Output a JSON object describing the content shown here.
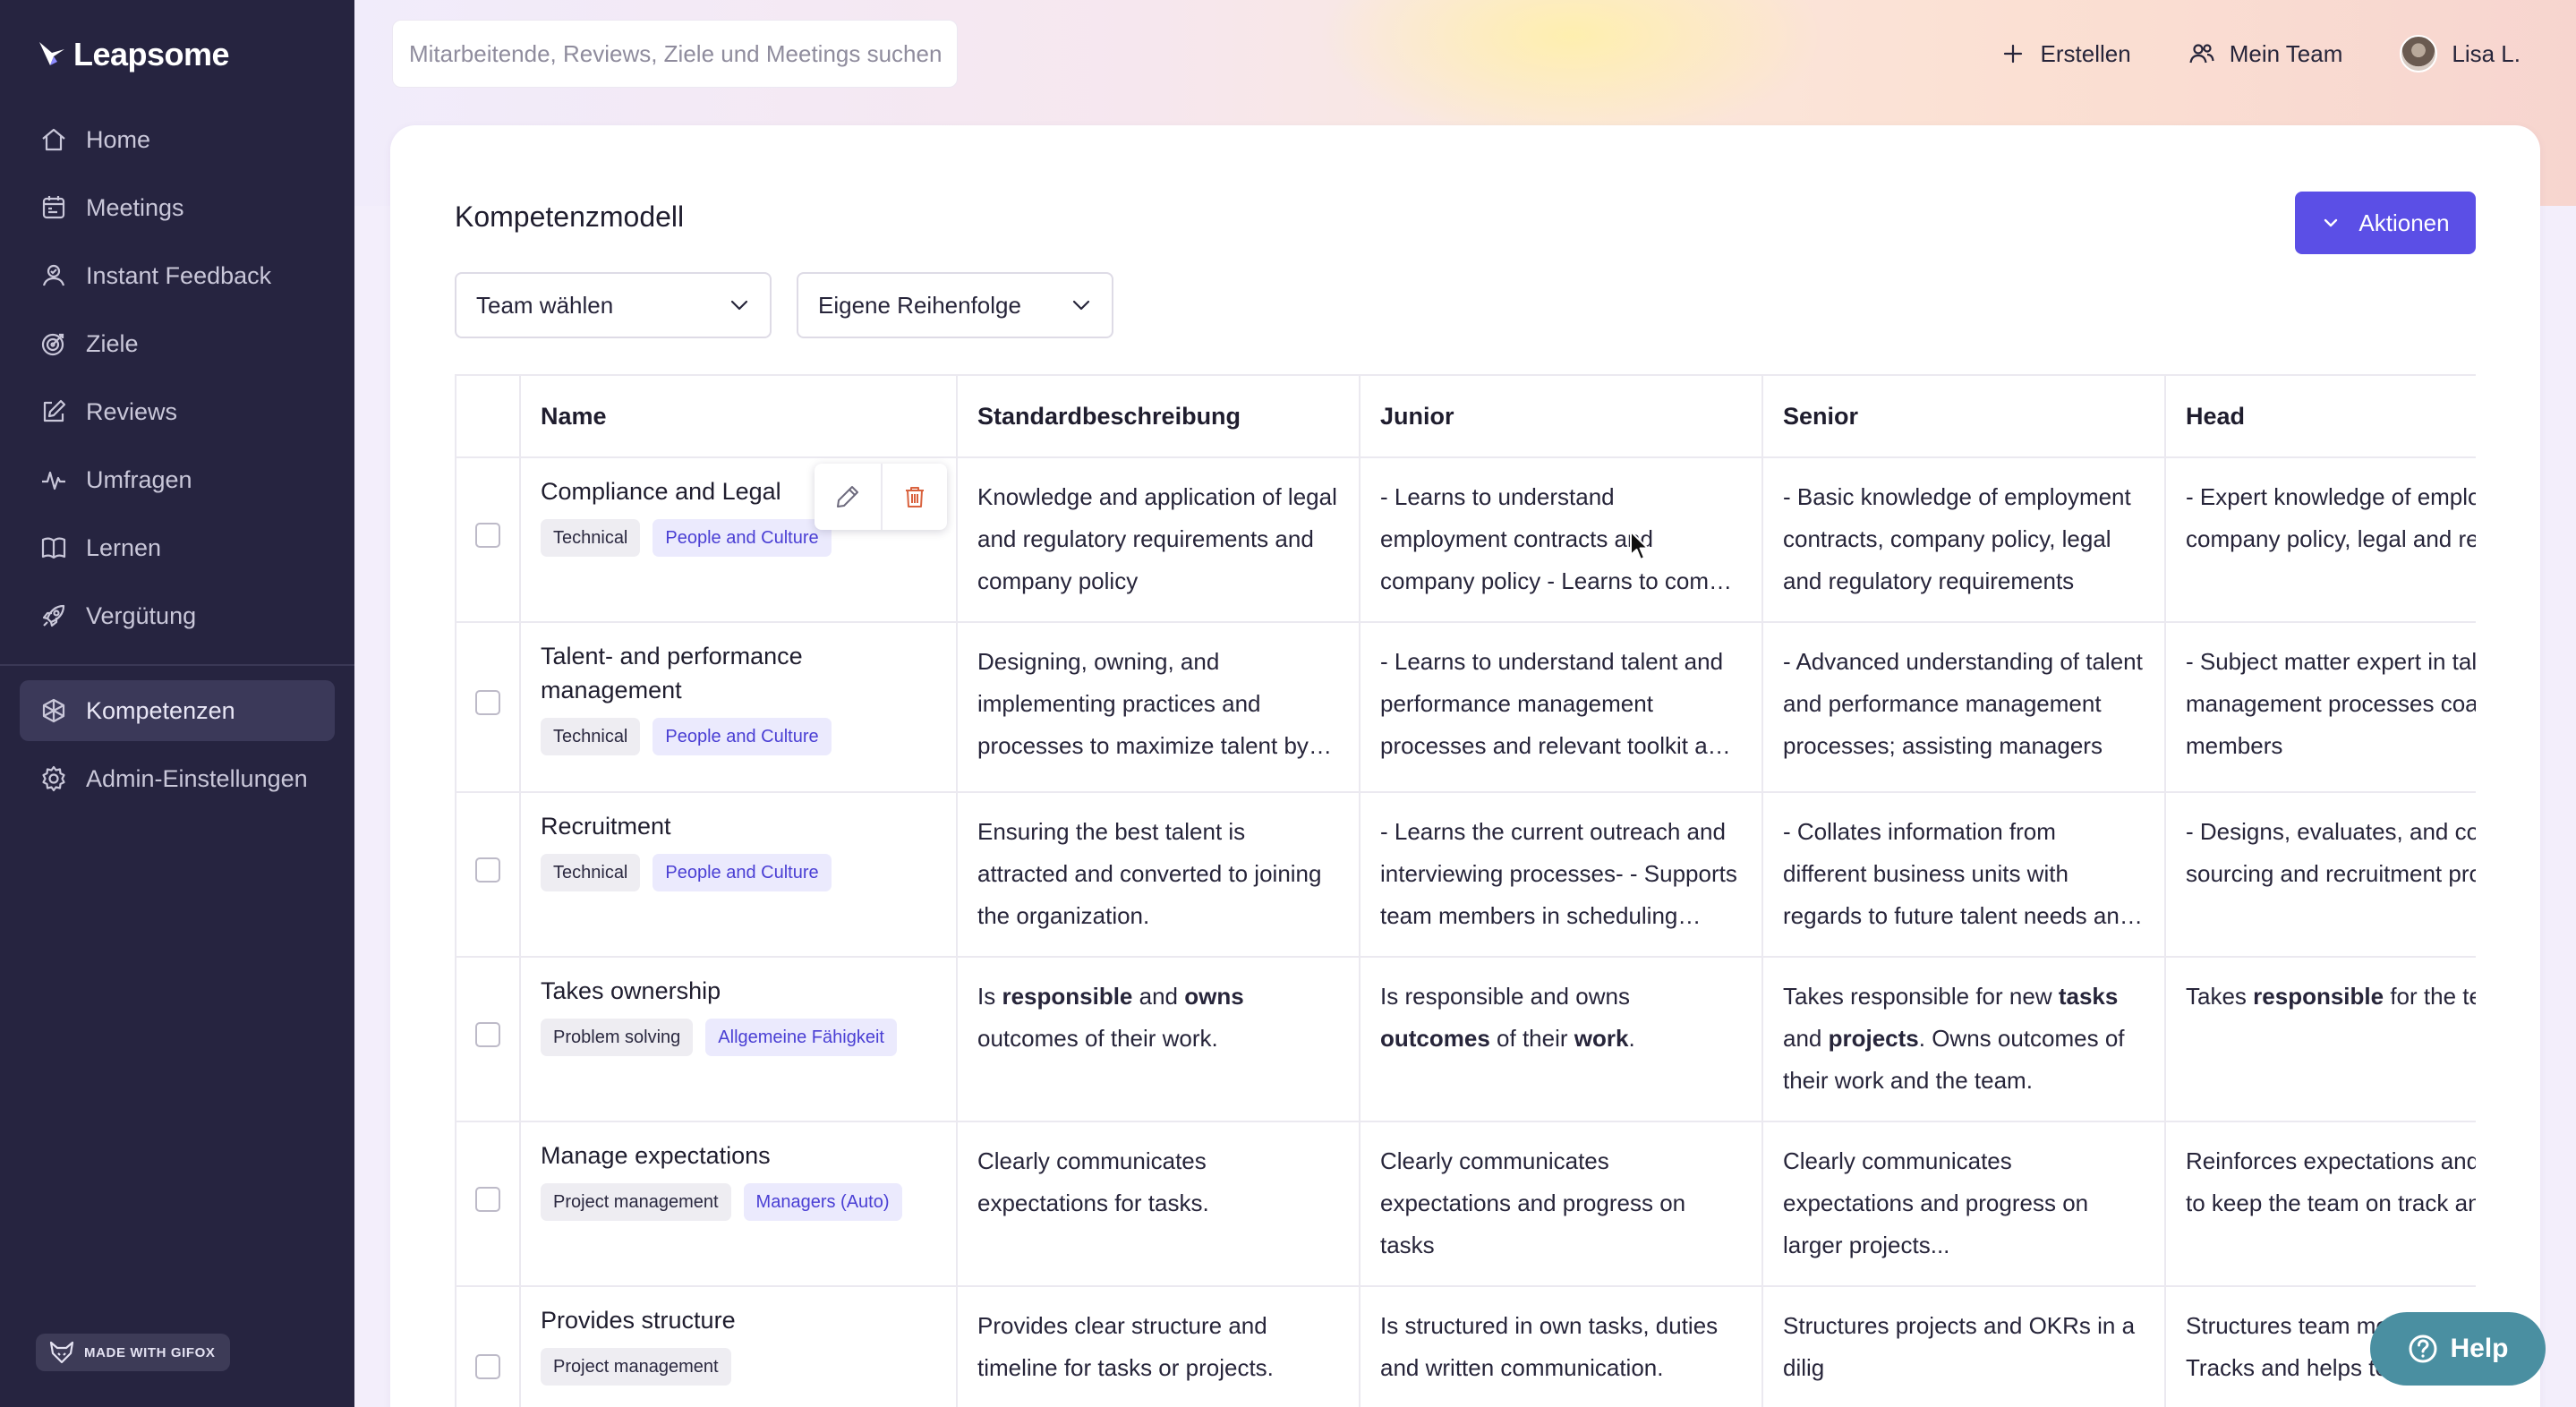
{
  "brand": {
    "name": "Leapsome"
  },
  "sidebar": {
    "items": [
      {
        "label": "Home",
        "icon": "home-icon"
      },
      {
        "label": "Meetings",
        "icon": "calendar-icon"
      },
      {
        "label": "Instant Feedback",
        "icon": "feedback-icon"
      },
      {
        "label": "Ziele",
        "icon": "target-icon"
      },
      {
        "label": "Reviews",
        "icon": "edit-icon"
      },
      {
        "label": "Umfragen",
        "icon": "pulse-icon"
      },
      {
        "label": "Lernen",
        "icon": "book-icon"
      },
      {
        "label": "Vergütung",
        "icon": "rocket-icon"
      }
    ],
    "bottom_items": [
      {
        "label": "Kompetenzen",
        "icon": "competency-icon",
        "active": true
      },
      {
        "label": "Admin-Einstellungen",
        "icon": "gear-icon"
      }
    ],
    "gifox_badge": "MADE WITH GIFOX"
  },
  "topbar": {
    "search_placeholder": "Mitarbeitende, Reviews, Ziele und Meetings suchen",
    "create_label": "Erstellen",
    "team_label": "Mein Team",
    "user_label": "Lisa L."
  },
  "page": {
    "title": "Kompetenzmodell",
    "actions_label": "Aktionen",
    "team_select": "Team wählen",
    "order_select": "Eigene Reihenfolge"
  },
  "table": {
    "headers": [
      "Name",
      "Standardbeschreibung",
      "Junior",
      "Senior",
      "Head"
    ],
    "rows": [
      {
        "name": "Compliance and Legal",
        "tags": [
          "Technical",
          "People and Culture"
        ],
        "standard": "Knowledge and application of legal and regulatory requirements and company policy",
        "junior": "- Learns to understand employment contracts and company policy - Learns to comply with legal and regulatory requirements",
        "senior": "- Basic knowledge of employment contracts, company policy, legal and regulatory requirements",
        "head": "- Expert knowledge of employment contracts, company policy, legal and regulatory requirements"
      },
      {
        "name": "Talent- and performance management",
        "tags": [
          "Technical",
          "People and Culture"
        ],
        "standard": "Designing, owning, and implementing practices and processes to maximize talent by developing employees",
        "junior": "- Learns to understand talent and performance management processes and relevant toolkit and frameworks",
        "senior": "- Advanced understanding of talent and performance management processes; assisting managers",
        "head": "- Subject matter expert in talent and performance management processes coaches junior team members"
      },
      {
        "name": "Recruitment",
        "tags": [
          "Technical",
          "People and Culture"
        ],
        "standard": "Ensuring the best talent is attracted and converted to joining the organization.",
        "junior": "- Learns the current outreach and interviewing processes- - Supports team members in scheduling interviews",
        "senior": "- Collates information from different business units with regards to future talent needs and hiring plans",
        "head": "- Designs, evaluates, and continuously improves sourcing and recruitment process in the company"
      },
      {
        "name": "Takes ownership",
        "tags": [
          "Problem solving",
          "Allgemeine Fähigkeit"
        ],
        "standard_rich": [
          "Is ",
          "responsible",
          " and ",
          "owns",
          " outcomes of their work."
        ],
        "junior_rich": [
          "Is responsible and owns ",
          "outcomes",
          " of their ",
          "work",
          "."
        ],
        "senior_rich": [
          "Takes responsible for new ",
          "tasks",
          " and ",
          "projects",
          ". Owns outcomes of their work and the team."
        ],
        "head_rich": [
          "Takes ",
          "responsible",
          " for the team's progress."
        ]
      },
      {
        "name": "Manage expectations",
        "tags": [
          "Project management",
          "Managers (Auto)"
        ],
        "standard": "Clearly communicates expectations for tasks.",
        "junior": "Clearly communicates expectations and progress on tasks",
        "senior": "Clearly communicates expectations and progress on larger projects...",
        "head": "Reinforces expectations and makes adjustments to keep the team on track and aligned with goals"
      },
      {
        "name": "Provides structure",
        "tags": [
          "Project management"
        ],
        "standard": "Provides clear structure and timeline for tasks or projects.",
        "junior": "Is structured in own tasks, duties and written communication.",
        "senior": "Structures projects and OKRs in a dilig",
        "head": "Structures team meetings and team progress. Tracks and helps team to reach goals"
      }
    ]
  },
  "help": {
    "label": "Help"
  },
  "colors": {
    "sidebar_bg": "#262440",
    "accent": "#5b4fe6",
    "help_bg": "#4a8fa1"
  }
}
